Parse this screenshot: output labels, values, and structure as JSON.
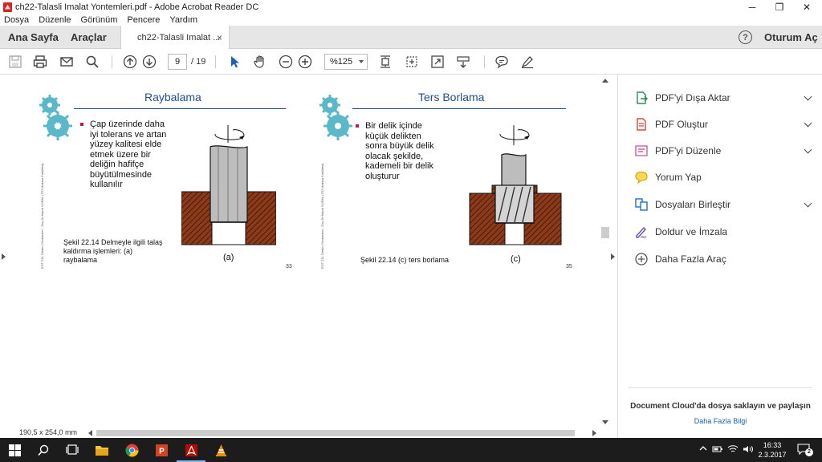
{
  "window": {
    "title": "ch22-Talasli Imalat Yontemleri.pdf - Adobe Acrobat Reader DC",
    "minimize": "─",
    "maximize": "❐",
    "close": "✕"
  },
  "menu": [
    "Dosya",
    "Düzenle",
    "Görünüm",
    "Pencere",
    "Yardım"
  ],
  "tabs": {
    "home": "Ana Sayfa",
    "tools": "Araçlar",
    "document": "ch22-Talasli Imalat ...",
    "close": "×",
    "help": "?",
    "signin": "Oturum Aç"
  },
  "toolbar": {
    "page_current": "9",
    "page_total": "/ 19",
    "zoom": "%125"
  },
  "slides": [
    {
      "title": "Raybalama",
      "bullet": "Çap üzerinde daha iyi tolerans ve artan yüzey kalitesi elde etmek üzere bir deliğin hafifçe büyütülmesinde kullanılır",
      "caption": "Şekil 22.14  Delmeyle ilgili talaş kaldırma işlemleri: (a) raybalama",
      "figure_label": "(a)",
      "page_number": "33",
      "side_note": "EÜT 231 Üretim Yöntemleri - Doç.Dr.Murat VURAL (İTÜ Makina Fakültesi)"
    },
    {
      "title": "Ters Borlama",
      "bullet": "Bir delik içinde küçük delikten sonra büyük delik olacak şekilde, kademeli bir delik oluşturur",
      "caption": "Şekil 22.14 (c) ters borlama",
      "figure_label": "(c)",
      "page_number": "35",
      "side_note": "EÜT 231 Üretim Yöntemleri - Doç.Dr.Murat VURAL (İTÜ Makina Fakültesi)"
    }
  ],
  "status": {
    "page_size": "190,5 x 254,0 mm"
  },
  "right_panel": {
    "items": [
      {
        "label": "PDF'yi Dışa Aktar",
        "icon": "export-pdf-icon",
        "color": "#2e8b57",
        "expandable": true
      },
      {
        "label": "PDF Oluştur",
        "icon": "create-pdf-icon",
        "color": "#e0453a",
        "expandable": true
      },
      {
        "label": "PDF'yi Düzenle",
        "icon": "edit-pdf-icon",
        "color": "#d65aa5",
        "expandable": true
      },
      {
        "label": "Yorum Yap",
        "icon": "comment-icon",
        "color": "#f2b705",
        "expandable": false
      },
      {
        "label": "Dosyaları Birleştir",
        "icon": "combine-files-icon",
        "color": "#1a73c8",
        "expandable": true
      },
      {
        "label": "Doldur ve İmzala",
        "icon": "fill-sign-icon",
        "color": "#6a4fb3",
        "expandable": false
      },
      {
        "label": "Daha Fazla Araç",
        "icon": "more-tools-icon",
        "color": "#555555",
        "expandable": false
      }
    ],
    "cloud_text": "Document Cloud'da dosya saklayın ve paylaşın",
    "cloud_link": "Daha Fazla Bilgi"
  },
  "taskbar": {
    "time": "16:33",
    "date": "2.3.2017",
    "notification_count": "2"
  }
}
